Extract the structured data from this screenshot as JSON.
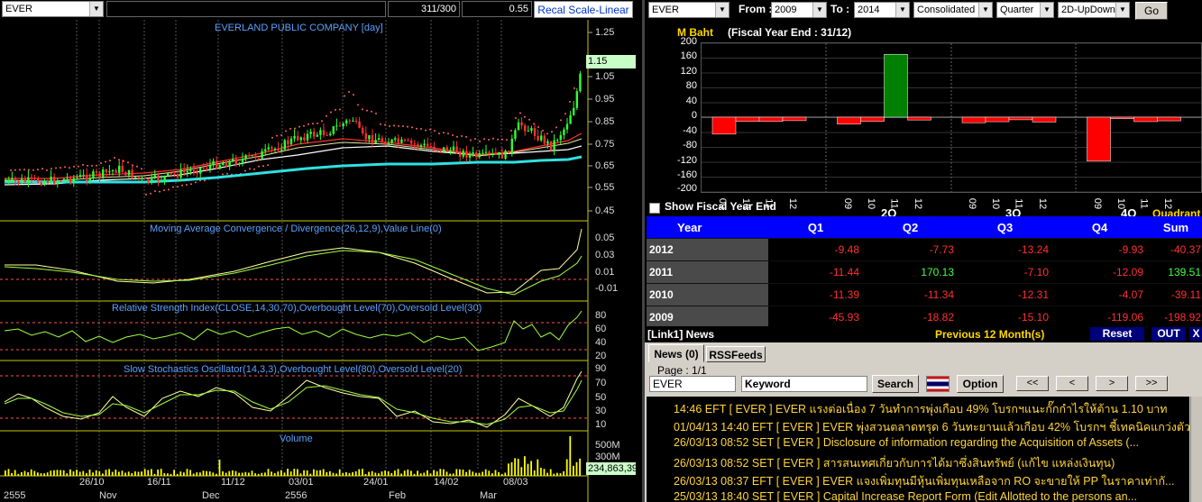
{
  "chart": {
    "symbol": "EVER",
    "price_box": "311/300",
    "price_box2": "0.55",
    "scale_button": "Recal Scale-Linear",
    "title": "EVERLAND PUBLIC COMPANY [day]",
    "price_label": "1.15",
    "price_axis": [
      "1.25",
      "1.15",
      "1.05",
      "0.95",
      "0.85",
      "0.75",
      "0.65",
      "0.55",
      "0.45"
    ],
    "macd_title": "Moving Average Convergence / Divergence(26,12,9),Value Line(0)",
    "macd_axis": [
      "0.05",
      "0.03",
      "0.01",
      "-0.01"
    ],
    "rsi_title": "Relative Strength Index(CLOSE,14,30,70),Overbought Level(70),Oversold Level(30)",
    "rsi_axis": [
      "80",
      "60",
      "40",
      "20"
    ],
    "stoch_title": "Slow Stochastics Oscillator(14,3,3),Overbought Level(80),Oversold Level(20)",
    "stoch_axis": [
      "90",
      "70",
      "50",
      "30",
      "10"
    ],
    "volume_title": "Volume",
    "volume_axis": [
      "500M",
      "300M"
    ],
    "volume_label": "234,863,39",
    "date_row1": [
      "26/10",
      "16/11",
      "11/12",
      "03/01",
      "24/01",
      "14/02",
      "08/03"
    ],
    "date_row2": [
      "2555",
      "Nov",
      "Dec",
      "2556",
      "Feb",
      "Mar"
    ]
  },
  "financial": {
    "symbol": "EVER",
    "from_label": "From :",
    "from_value": "2009",
    "to_label": "To :",
    "to_value": "2014",
    "type": "Consolidated",
    "period": "Quarter",
    "view": "2D-UpDown",
    "go_label": "Go",
    "unit": "M Baht",
    "fiscal": "(Fiscal Year End : 31/12)",
    "y_axis": [
      "200",
      "160",
      "120",
      "80",
      "40",
      "0",
      "-40",
      "-80",
      "-120",
      "-160",
      "-200"
    ],
    "x_labels": [
      "09",
      "10",
      "11",
      "12",
      "09",
      "10",
      "11",
      "12",
      "09",
      "10",
      "11",
      "12",
      "09",
      "10",
      "11",
      "12"
    ],
    "quarter_labels": [
      "2Q",
      "3Q",
      "4Q"
    ],
    "quadrant_label": "Quadrant",
    "show_fiscal_label": "Show Fiscal Year End",
    "headers": [
      "Year",
      "Q1",
      "Q2",
      "Q3",
      "Q4",
      "Sum"
    ],
    "rows": [
      {
        "year": "2012",
        "q1": "-9.48",
        "q2": "-7.73",
        "q3": "-13.24",
        "q4": "-9.93",
        "sum": "-40.37"
      },
      {
        "year": "2011",
        "q1": "-11.44",
        "q2": "170.13",
        "q3": "-7.10",
        "q4": "-12.09",
        "sum": "139.51"
      },
      {
        "year": "2010",
        "q1": "-11.39",
        "q2": "-11.34",
        "q3": "-12.31",
        "q4": "-4.07",
        "sum": "-39.11"
      },
      {
        "year": "2009",
        "q1": "-45.93",
        "q2": "-18.82",
        "q3": "-15.10",
        "q4": "-119.06",
        "sum": "-198.92"
      }
    ]
  },
  "news": {
    "panel_title": "[Link1] News",
    "previous_label": "Previous 12 Month(s)",
    "reset_label": "Reset",
    "out_label": "OUT",
    "x_label": "X",
    "tab_news": "News (0)",
    "tab_rss": "RSSFeeds",
    "page_label": "Page : 1/1",
    "symbol_value": "EVER",
    "keyword_value": "Keyword",
    "search_label": "Search",
    "option_label": "Option",
    "nav": [
      "<<",
      "<",
      ">",
      ">>"
    ],
    "items": [
      "14:46  EFT  [ EVER ]  EVER แรงต่อเนื่อง 7 วันทำการพุ่งเกือบ 49% โบรกฯแนะกั๊กกำไรให้ต้าน 1.10 บาท",
      "01/04/13 14:40  EFT  [ EVER ]  EVER พุ่งสวนตลาดทรุด 6 วันทะยานแล้วเกือบ 42% โบรกฯ ชี้เทคนิคแกว่งตัว ...",
      "26/03/13 08:52  SET  [ EVER ]  Disclosure of information regarding the Acquisition of Assets (...",
      "26/03/13 08:52  SET  [ EVER ]  สารสนเทศเกี่ยวกับการได้มาซึ่งสินทรัพย์ (แก้ไข แหล่งเงินทุน)",
      "26/03/13 08:37  EFT  [ EVER ]  EVER แจงเพิ่มทุนมีหุ้นเพิ่มทุนเหลือจาก RO จะขายให้ PP ในราคาเท่ากั...",
      "25/03/13 18:40  SET  [ EVER ]  Capital Increase Report Form (Edit Allotted  to the persons an..."
    ]
  }
}
